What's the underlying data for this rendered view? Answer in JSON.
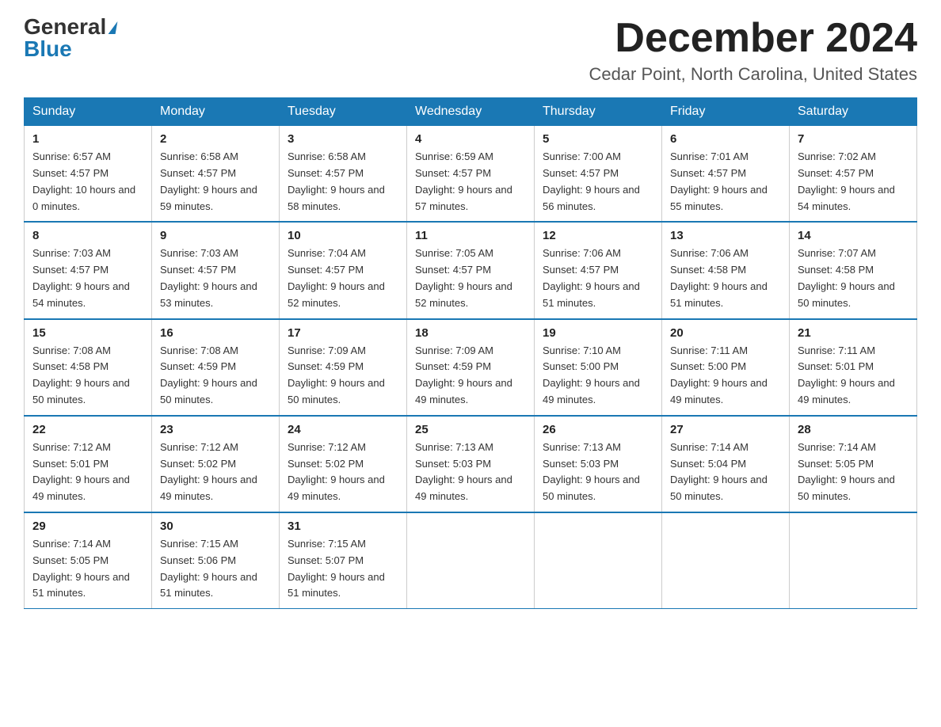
{
  "logo": {
    "general": "General",
    "blue": "Blue"
  },
  "title": "December 2024",
  "location": "Cedar Point, North Carolina, United States",
  "days_of_week": [
    "Sunday",
    "Monday",
    "Tuesday",
    "Wednesday",
    "Thursday",
    "Friday",
    "Saturday"
  ],
  "weeks": [
    [
      {
        "day": "1",
        "sunrise": "6:57 AM",
        "sunset": "4:57 PM",
        "daylight": "10 hours and 0 minutes."
      },
      {
        "day": "2",
        "sunrise": "6:58 AM",
        "sunset": "4:57 PM",
        "daylight": "9 hours and 59 minutes."
      },
      {
        "day": "3",
        "sunrise": "6:58 AM",
        "sunset": "4:57 PM",
        "daylight": "9 hours and 58 minutes."
      },
      {
        "day": "4",
        "sunrise": "6:59 AM",
        "sunset": "4:57 PM",
        "daylight": "9 hours and 57 minutes."
      },
      {
        "day": "5",
        "sunrise": "7:00 AM",
        "sunset": "4:57 PM",
        "daylight": "9 hours and 56 minutes."
      },
      {
        "day": "6",
        "sunrise": "7:01 AM",
        "sunset": "4:57 PM",
        "daylight": "9 hours and 55 minutes."
      },
      {
        "day": "7",
        "sunrise": "7:02 AM",
        "sunset": "4:57 PM",
        "daylight": "9 hours and 54 minutes."
      }
    ],
    [
      {
        "day": "8",
        "sunrise": "7:03 AM",
        "sunset": "4:57 PM",
        "daylight": "9 hours and 54 minutes."
      },
      {
        "day": "9",
        "sunrise": "7:03 AM",
        "sunset": "4:57 PM",
        "daylight": "9 hours and 53 minutes."
      },
      {
        "day": "10",
        "sunrise": "7:04 AM",
        "sunset": "4:57 PM",
        "daylight": "9 hours and 52 minutes."
      },
      {
        "day": "11",
        "sunrise": "7:05 AM",
        "sunset": "4:57 PM",
        "daylight": "9 hours and 52 minutes."
      },
      {
        "day": "12",
        "sunrise": "7:06 AM",
        "sunset": "4:57 PM",
        "daylight": "9 hours and 51 minutes."
      },
      {
        "day": "13",
        "sunrise": "7:06 AM",
        "sunset": "4:58 PM",
        "daylight": "9 hours and 51 minutes."
      },
      {
        "day": "14",
        "sunrise": "7:07 AM",
        "sunset": "4:58 PM",
        "daylight": "9 hours and 50 minutes."
      }
    ],
    [
      {
        "day": "15",
        "sunrise": "7:08 AM",
        "sunset": "4:58 PM",
        "daylight": "9 hours and 50 minutes."
      },
      {
        "day": "16",
        "sunrise": "7:08 AM",
        "sunset": "4:59 PM",
        "daylight": "9 hours and 50 minutes."
      },
      {
        "day": "17",
        "sunrise": "7:09 AM",
        "sunset": "4:59 PM",
        "daylight": "9 hours and 50 minutes."
      },
      {
        "day": "18",
        "sunrise": "7:09 AM",
        "sunset": "4:59 PM",
        "daylight": "9 hours and 49 minutes."
      },
      {
        "day": "19",
        "sunrise": "7:10 AM",
        "sunset": "5:00 PM",
        "daylight": "9 hours and 49 minutes."
      },
      {
        "day": "20",
        "sunrise": "7:11 AM",
        "sunset": "5:00 PM",
        "daylight": "9 hours and 49 minutes."
      },
      {
        "day": "21",
        "sunrise": "7:11 AM",
        "sunset": "5:01 PM",
        "daylight": "9 hours and 49 minutes."
      }
    ],
    [
      {
        "day": "22",
        "sunrise": "7:12 AM",
        "sunset": "5:01 PM",
        "daylight": "9 hours and 49 minutes."
      },
      {
        "day": "23",
        "sunrise": "7:12 AM",
        "sunset": "5:02 PM",
        "daylight": "9 hours and 49 minutes."
      },
      {
        "day": "24",
        "sunrise": "7:12 AM",
        "sunset": "5:02 PM",
        "daylight": "9 hours and 49 minutes."
      },
      {
        "day": "25",
        "sunrise": "7:13 AM",
        "sunset": "5:03 PM",
        "daylight": "9 hours and 49 minutes."
      },
      {
        "day": "26",
        "sunrise": "7:13 AM",
        "sunset": "5:03 PM",
        "daylight": "9 hours and 50 minutes."
      },
      {
        "day": "27",
        "sunrise": "7:14 AM",
        "sunset": "5:04 PM",
        "daylight": "9 hours and 50 minutes."
      },
      {
        "day": "28",
        "sunrise": "7:14 AM",
        "sunset": "5:05 PM",
        "daylight": "9 hours and 50 minutes."
      }
    ],
    [
      {
        "day": "29",
        "sunrise": "7:14 AM",
        "sunset": "5:05 PM",
        "daylight": "9 hours and 51 minutes."
      },
      {
        "day": "30",
        "sunrise": "7:15 AM",
        "sunset": "5:06 PM",
        "daylight": "9 hours and 51 minutes."
      },
      {
        "day": "31",
        "sunrise": "7:15 AM",
        "sunset": "5:07 PM",
        "daylight": "9 hours and 51 minutes."
      },
      null,
      null,
      null,
      null
    ]
  ]
}
